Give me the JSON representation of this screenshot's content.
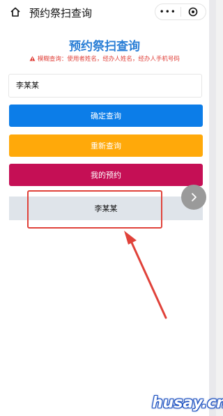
{
  "header": {
    "title": "预约祭扫查询",
    "more_label": "•••"
  },
  "main": {
    "title": "预约祭扫查询",
    "notice": "模糊查询：使用者姓名，经办人姓名，经办人手机号码",
    "notice_icon": "warning-icon"
  },
  "search": {
    "value": "李某某"
  },
  "buttons": {
    "confirm": "确定查询",
    "reset": "重新查询",
    "mine": "我的预约"
  },
  "result": {
    "name": "李某某"
  },
  "watermark": "husay.cn",
  "colors": {
    "title": "#2b7fd6",
    "notice": "#e0413a",
    "confirm": "#0c7de8",
    "reset": "#ffa90a",
    "mine": "#c50f55",
    "result_bg": "#dfe4ea",
    "annotation": "#e0423a"
  }
}
